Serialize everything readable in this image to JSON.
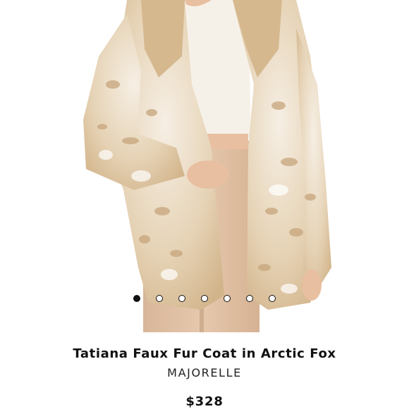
{
  "carousel": {
    "slide_count": 7,
    "active_index": 0
  },
  "product": {
    "title": "Tatiana Faux Fur Coat in Arctic Fox",
    "brand": "MAJORELLE",
    "price": "$328"
  },
  "colors": {
    "fur_tan": "#d9bf9a",
    "fur_cream": "#f4ede2",
    "pants": "#e0c2a6",
    "top": "#f6f1e8",
    "skin": "#e8bfa0"
  }
}
